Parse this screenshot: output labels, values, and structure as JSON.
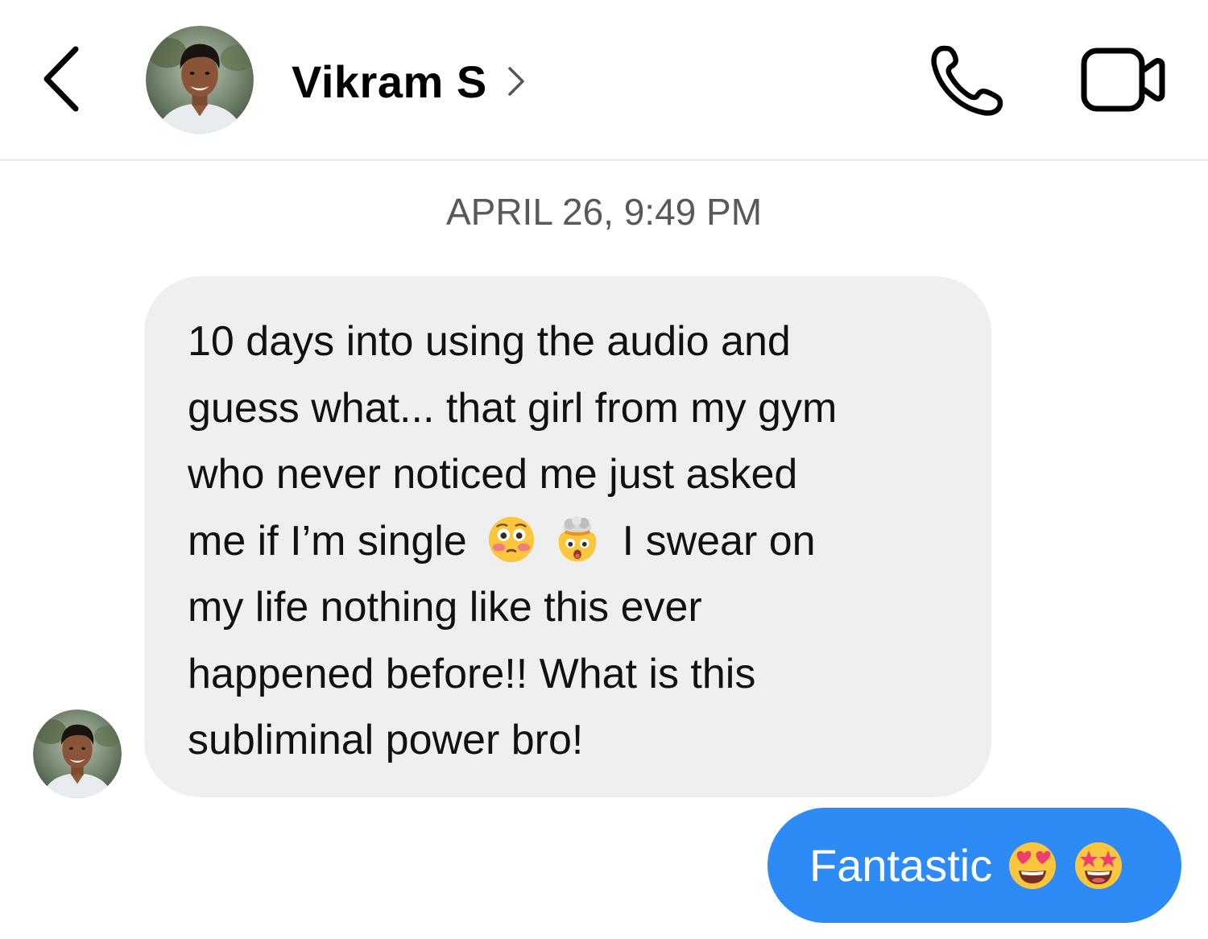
{
  "header": {
    "contact_name": "Vikram S",
    "back_icon": "chevron-left-icon",
    "call_icon": "phone-icon",
    "video_icon": "video-camera-icon"
  },
  "conversation": {
    "timestamp": "APRIL 26, 9:49 PM",
    "incoming": {
      "line1": "10 days into using the audio and",
      "line2": "guess what... that girl from my gym",
      "line3": "who never noticed me just asked",
      "line4a": "me if I’m single",
      "line4b": "I swear on",
      "line5": "my life nothing like this ever",
      "line6": "happened before!! What is this",
      "line7": "subliminal power bro!",
      "emojis": [
        "flushed-face",
        "exploding-head"
      ]
    },
    "outgoing": {
      "text": "Fantastic",
      "emojis": [
        "heart-eyes",
        "star-struck"
      ]
    }
  },
  "colors": {
    "incoming_bubble": "#efefef",
    "outgoing_bubble": "#2e8bf6",
    "timestamp": "#595959",
    "divider": "#ececec"
  }
}
